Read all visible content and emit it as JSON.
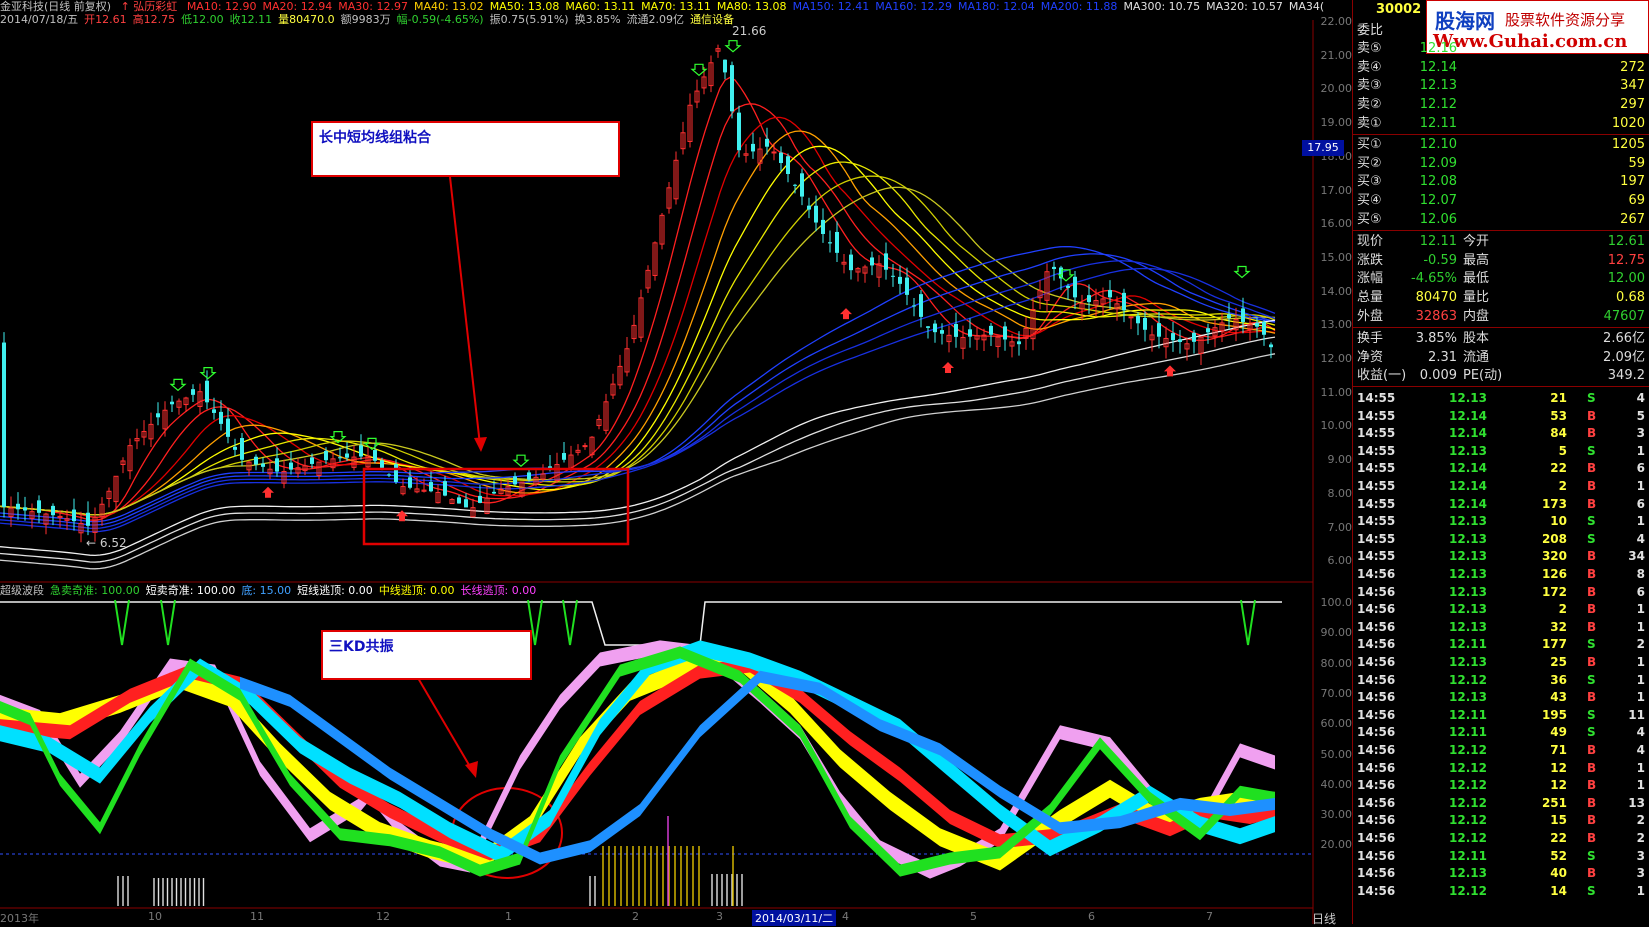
{
  "header": {
    "stock": "金亚科技(日线 前复权)",
    "indicator": "↑ 弘历彩虹",
    "ma": [
      {
        "label": "MA10: 12.90",
        "color": "#ff3030"
      },
      {
        "label": "MA20: 12.94",
        "color": "#ff3030"
      },
      {
        "label": "MA30: 12.97",
        "color": "#ff3030"
      },
      {
        "label": "MA40: 13.02",
        "color": "#ffd000"
      },
      {
        "label": "MA50: 13.08",
        "color": "#ffff00"
      },
      {
        "label": "MA60: 13.11",
        "color": "#ffff00"
      },
      {
        "label": "MA70: 13.11",
        "color": "#ffff00"
      },
      {
        "label": "MA80: 13.08",
        "color": "#ffff00"
      },
      {
        "label": "MA150: 12.41",
        "color": "#2040ff"
      },
      {
        "label": "MA160: 12.29",
        "color": "#2040ff"
      },
      {
        "label": "MA180: 12.04",
        "color": "#2040ff"
      },
      {
        "label": "MA200: 11.88",
        "color": "#2040ff"
      },
      {
        "label": "MA300: 10.75",
        "color": "#e0e0e0"
      },
      {
        "label": "MA320: 10.57",
        "color": "#e0e0e0"
      },
      {
        "label": "MA34(",
        "color": "#e0e0e0"
      }
    ],
    "line2": [
      {
        "label": "2014/07/18/五",
        "color": "#c0c0c0"
      },
      {
        "label": "开12.61",
        "color": "#ff4040"
      },
      {
        "label": "高12.75",
        "color": "#ff4040"
      },
      {
        "label": "低12.00",
        "color": "#30d030"
      },
      {
        "label": "收12.11",
        "color": "#30d030"
      },
      {
        "label": "量80470.0",
        "color": "#ffff40"
      },
      {
        "label": "额9983万",
        "color": "#c0c0c0"
      },
      {
        "label": "幅-0.59(-4.65%)",
        "color": "#30d030"
      },
      {
        "label": "振0.75(5.91%)",
        "color": "#c0c0c0"
      },
      {
        "label": "换3.85%",
        "color": "#c0c0c0"
      },
      {
        "label": "流通2.09亿",
        "color": "#c0c0c0"
      },
      {
        "label": "通信设备",
        "color": "#ffff40"
      }
    ],
    "sub": [
      {
        "label": "超级波段",
        "color": "#c0c0c0"
      },
      {
        "label": "急卖奇准: 100.00",
        "color": "#30d030"
      },
      {
        "label": "短卖奇准: 100.00",
        "color": "#ffffff"
      },
      {
        "label": "底: 15.00",
        "color": "#40a0ff"
      },
      {
        "label": "短线逃顶: 0.00",
        "color": "#ffffff"
      },
      {
        "label": "中线逃顶: 0.00",
        "color": "#ffff00"
      },
      {
        "label": "长线逃顶: 0.00",
        "color": "#ff40ff"
      }
    ]
  },
  "price_axis": [
    "22.00",
    "21.00",
    "20.00",
    "19.00",
    "18.00",
    "17.00",
    "16.00",
    "15.00",
    "14.00",
    "13.00",
    "12.00",
    "11.00",
    "10.00",
    "9.00",
    "8.00",
    "7.00",
    "6.00"
  ],
  "current_price_tag": "17.95",
  "sub_axis": [
    "100.0",
    "90.00",
    "80.00",
    "70.00",
    "60.00",
    "50.00",
    "40.00",
    "30.00",
    "20.00"
  ],
  "x_axis": [
    "2013年",
    "10",
    "11",
    "12",
    "1",
    "2",
    "3",
    "2014/03/11/二",
    "4",
    "5",
    "6",
    "7"
  ],
  "period_label": "日线",
  "annotations": {
    "high": "21.66",
    "low": "6.52",
    "note1": "长中短均线组粘合",
    "note2": "三KD共振"
  },
  "logo": {
    "title": "股海网",
    "subtitle": "股票软件资源分享",
    "url": "Www.Guhai.com.cn",
    "code": "30002"
  },
  "panel": {
    "weibi_label": "委比",
    "sell": [
      {
        "label": "卖⑤",
        "price": "12.16",
        "vol": ""
      },
      {
        "label": "卖④",
        "price": "12.14",
        "vol": "272"
      },
      {
        "label": "卖③",
        "price": "12.13",
        "vol": "347"
      },
      {
        "label": "卖②",
        "price": "12.12",
        "vol": "297"
      },
      {
        "label": "卖①",
        "price": "12.11",
        "vol": "1020"
      }
    ],
    "buy": [
      {
        "label": "买①",
        "price": "12.10",
        "vol": "1205"
      },
      {
        "label": "买②",
        "price": "12.09",
        "vol": "59"
      },
      {
        "label": "买③",
        "price": "12.08",
        "vol": "197"
      },
      {
        "label": "买④",
        "price": "12.07",
        "vol": "69"
      },
      {
        "label": "买⑤",
        "price": "12.06",
        "vol": "267"
      }
    ],
    "stats": [
      {
        "l1": "现价",
        "v1": "12.11",
        "c1": "#30d030",
        "l2": "今开",
        "v2": "12.61",
        "c2": "#30d030"
      },
      {
        "l1": "涨跌",
        "v1": "-0.59",
        "c1": "#30d030",
        "l2": "最高",
        "v2": "12.75",
        "c2": "#ff4040"
      },
      {
        "l1": "涨幅",
        "v1": "-4.65%",
        "c1": "#30d030",
        "l2": "最低",
        "v2": "12.00",
        "c2": "#30d030"
      },
      {
        "l1": "总量",
        "v1": "80470",
        "c1": "#ffff40",
        "l2": "量比",
        "v2": "0.68",
        "c2": "#ffff40"
      },
      {
        "l1": "外盘",
        "v1": "32863",
        "c1": "#ff4040",
        "l2": "内盘",
        "v2": "47607",
        "c2": "#30d030"
      }
    ],
    "stats2": [
      {
        "l1": "换手",
        "v1": "3.85%",
        "l2": "股本",
        "v2": "2.66亿"
      },
      {
        "l1": "净资",
        "v1": "2.31",
        "l2": "流通",
        "v2": "2.09亿"
      },
      {
        "l1": "收益(一)",
        "v1": "0.009",
        "l2": "PE(动)",
        "v2": "349.2"
      }
    ],
    "ticks": [
      [
        "14:55",
        "12.13",
        "21",
        "S",
        "4"
      ],
      [
        "14:55",
        "12.14",
        "53",
        "B",
        "5"
      ],
      [
        "14:55",
        "12.14",
        "84",
        "B",
        "3"
      ],
      [
        "14:55",
        "12.13",
        "5",
        "S",
        "1"
      ],
      [
        "14:55",
        "12.14",
        "22",
        "B",
        "6"
      ],
      [
        "14:55",
        "12.14",
        "2",
        "B",
        "1"
      ],
      [
        "14:55",
        "12.14",
        "173",
        "B",
        "6"
      ],
      [
        "14:55",
        "12.13",
        "10",
        "S",
        "1"
      ],
      [
        "14:55",
        "12.13",
        "208",
        "S",
        "4"
      ],
      [
        "14:55",
        "12.13",
        "320",
        "B",
        "34"
      ],
      [
        "14:56",
        "12.13",
        "126",
        "B",
        "8"
      ],
      [
        "14:56",
        "12.13",
        "172",
        "B",
        "6"
      ],
      [
        "14:56",
        "12.13",
        "2",
        "B",
        "1"
      ],
      [
        "14:56",
        "12.13",
        "32",
        "B",
        "1"
      ],
      [
        "14:56",
        "12.11",
        "177",
        "S",
        "2"
      ],
      [
        "14:56",
        "12.13",
        "25",
        "B",
        "1"
      ],
      [
        "14:56",
        "12.12",
        "36",
        "S",
        "1"
      ],
      [
        "14:56",
        "12.13",
        "43",
        "B",
        "1"
      ],
      [
        "14:56",
        "12.11",
        "195",
        "S",
        "11"
      ],
      [
        "14:56",
        "12.11",
        "49",
        "S",
        "4"
      ],
      [
        "14:56",
        "12.12",
        "71",
        "B",
        "4"
      ],
      [
        "14:56",
        "12.12",
        "12",
        "B",
        "1"
      ],
      [
        "14:56",
        "12.12",
        "12",
        "B",
        "1"
      ],
      [
        "14:56",
        "12.12",
        "251",
        "B",
        "13"
      ],
      [
        "14:56",
        "12.12",
        "15",
        "B",
        "2"
      ],
      [
        "14:56",
        "12.12",
        "22",
        "B",
        "2"
      ],
      [
        "14:56",
        "12.11",
        "52",
        "S",
        "3"
      ],
      [
        "14:56",
        "12.13",
        "40",
        "B",
        "3"
      ],
      [
        "14:56",
        "12.12",
        "14",
        "S",
        "1"
      ]
    ]
  }
}
